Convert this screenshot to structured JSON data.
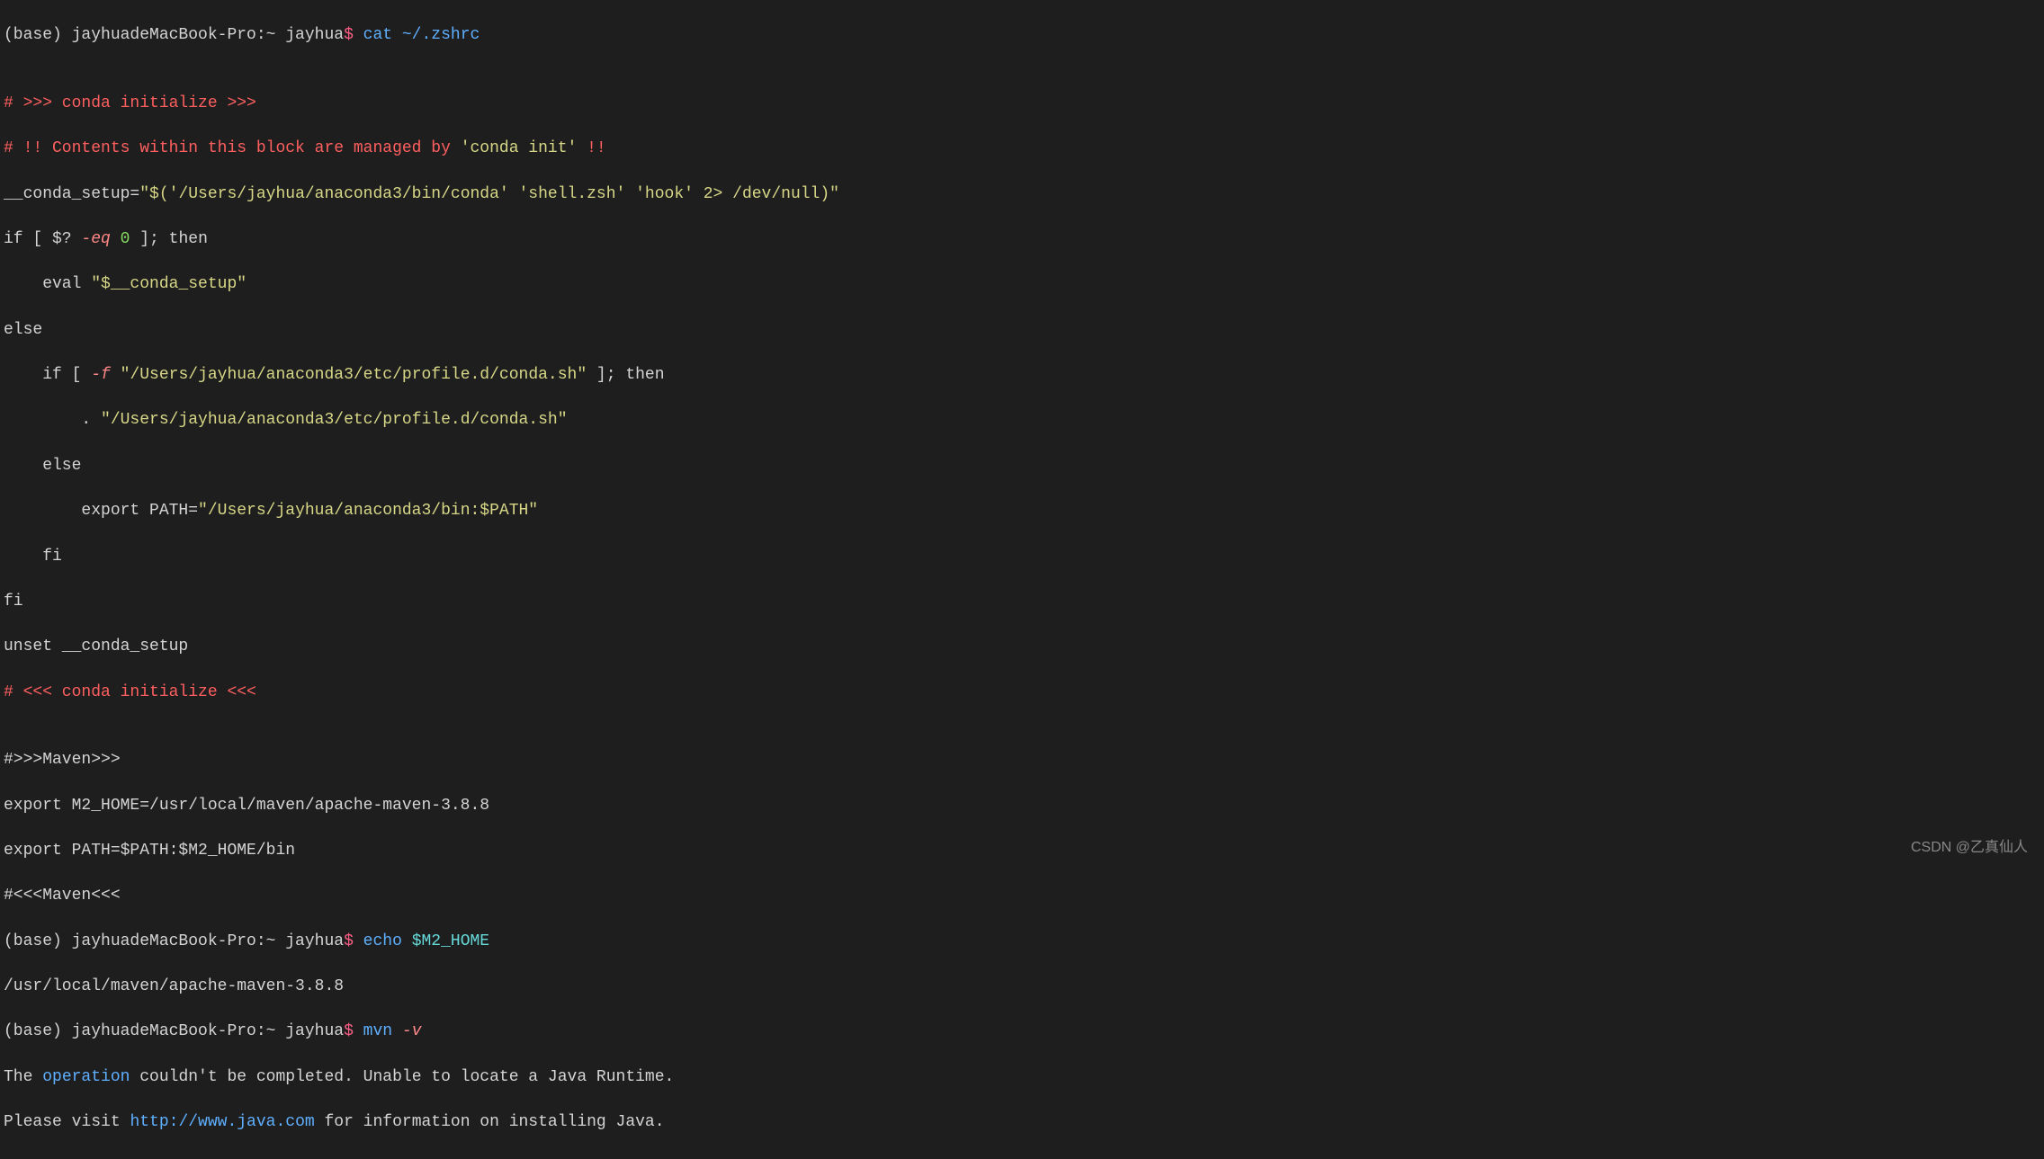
{
  "watermark": "CSDN @乙真仙人",
  "l1": {
    "host": "(base) jayhuadeMacBook-Pro:~ jayhua",
    "dollar": "$",
    "cmd": " cat ~/.zshrc"
  },
  "l2": "",
  "l3": "# >>> conda initialize >>>",
  "l4": {
    "a": "# !! Contents within this block are managed by ",
    "b": "'conda init'",
    "c": " !!"
  },
  "l5": {
    "a": "__conda_setup=",
    "b": "\"$('/Users/jayhua/anaconda3/bin/conda' 'shell.zsh' 'hook' 2> /dev/null)\""
  },
  "l6": {
    "a": "if [ $? ",
    "b": "-eq",
    "c": " ",
    "d": "0",
    "e": " ]; then"
  },
  "l7": {
    "a": "    eval ",
    "b": "\"$__conda_setup\""
  },
  "l8": "else",
  "l9": {
    "a": "    if [ ",
    "b": "-f",
    "c": " ",
    "d": "\"/Users/jayhua/anaconda3/etc/profile.d/conda.sh\"",
    "e": " ]; then"
  },
  "l10": {
    "a": "        . ",
    "b": "\"/Users/jayhua/anaconda3/etc/profile.d/conda.sh\""
  },
  "l11": "    else",
  "l12": {
    "a": "        export PATH=",
    "b": "\"/Users/jayhua/anaconda3/bin:$PATH\""
  },
  "l13": "    fi",
  "l14": "fi",
  "l15": "unset __conda_setup",
  "l16": "# <<< conda initialize <<<",
  "l17": "",
  "l18": "#>>>Maven>>>",
  "l19": "export M2_HOME=/usr/local/maven/apache-maven-3.8.8",
  "l20": "export PATH=$PATH:$M2_HOME/bin",
  "l21": "#<<<Maven<<<",
  "l22": {
    "host": "(base) jayhuadeMacBook-Pro:~ jayhua",
    "dollar": "$",
    "cmd1": " echo ",
    "var": "$M2_HOME"
  },
  "l23": "/usr/local/maven/apache-maven-3.8.8",
  "l24": {
    "host": "(base) jayhuadeMacBook-Pro:~ jayhua",
    "dollar": "$",
    "cmd1": " mvn ",
    "flag": "-v"
  },
  "l25": {
    "a": "The ",
    "b": "operation",
    "c": " couldn't be completed. Unable to locate a Java Runtime."
  },
  "l26": {
    "a": "Please visit ",
    "b": "http://www.java.com",
    "c": " for information on installing Java."
  }
}
